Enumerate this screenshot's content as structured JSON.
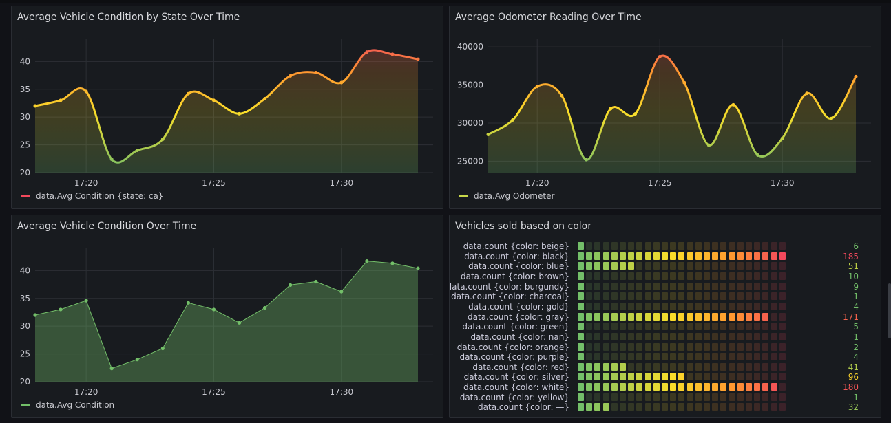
{
  "colors": {
    "green": "#73bf69",
    "yellow": "#fade2a",
    "orange": "#ff9830",
    "red": "#f2495c"
  },
  "panels": {
    "cond_state": {
      "title": "Average Vehicle Condition by State Over Time",
      "legend": "data.Avg Condition {state: ca}"
    },
    "odometer": {
      "title": "Average Odometer Reading Over Time",
      "legend": "data.Avg Odometer"
    },
    "cond": {
      "title": "Average Vehicle Condition Over Time",
      "legend": "data.Avg Condition"
    },
    "colors_sold": {
      "title": "Vehicles sold based on color"
    }
  },
  "chart_data": [
    {
      "type": "line",
      "title": "Average Vehicle Condition by State Over Time",
      "x": [
        "17:18",
        "17:19",
        "17:20",
        "17:21",
        "17:22",
        "17:23",
        "17:24",
        "17:25",
        "17:26",
        "17:27",
        "17:28",
        "17:29",
        "17:30",
        "17:31",
        "17:32",
        "17:33"
      ],
      "x_ticks": [
        "17:20",
        "17:25",
        "17:30"
      ],
      "series": [
        {
          "name": "data.Avg Condition {state: ca}",
          "values": [
            32,
            33,
            34.6,
            22.4,
            24,
            26,
            34.2,
            33,
            30.6,
            33.3,
            37.4,
            38,
            36.2,
            41.7,
            41.3,
            40.4
          ]
        }
      ],
      "ylim": [
        20,
        44
      ],
      "y_ticks": [
        20,
        25,
        30,
        35,
        40
      ],
      "line_style": "smooth",
      "color_scheme": "green-yellow-red gradient",
      "grid": true,
      "legend": "bottom-left"
    },
    {
      "type": "line",
      "title": "Average Odometer Reading Over Time",
      "x": [
        "17:18",
        "17:19",
        "17:20",
        "17:21",
        "17:22",
        "17:23",
        "17:24",
        "17:25",
        "17:26",
        "17:27",
        "17:28",
        "17:29",
        "17:30",
        "17:31",
        "17:32",
        "17:33"
      ],
      "x_ticks": [
        "17:20",
        "17:25",
        "17:30"
      ],
      "series": [
        {
          "name": "data.Avg Odometer",
          "values": [
            28500,
            30400,
            34800,
            33600,
            25200,
            31900,
            31200,
            38700,
            35300,
            27100,
            32400,
            25800,
            28000,
            33900,
            30600,
            36100
          ]
        }
      ],
      "ylim": [
        23500,
        41000
      ],
      "y_ticks": [
        25000,
        30000,
        35000,
        40000
      ],
      "line_style": "smooth",
      "color_scheme": "green-yellow-red gradient",
      "grid": true,
      "legend": "bottom-left"
    },
    {
      "type": "line",
      "title": "Average Vehicle Condition Over Time",
      "x": [
        "17:18",
        "17:19",
        "17:20",
        "17:21",
        "17:22",
        "17:23",
        "17:24",
        "17:25",
        "17:26",
        "17:27",
        "17:28",
        "17:29",
        "17:30",
        "17:31",
        "17:32",
        "17:33"
      ],
      "x_ticks": [
        "17:20",
        "17:25",
        "17:30"
      ],
      "series": [
        {
          "name": "data.Avg Condition",
          "values": [
            32,
            33,
            34.6,
            22.4,
            24,
            26,
            34.2,
            33,
            30.6,
            33.3,
            37.4,
            38,
            36.2,
            41.7,
            41.3,
            40.4
          ]
        }
      ],
      "ylim": [
        20,
        44
      ],
      "y_ticks": [
        20,
        25,
        30,
        35,
        40
      ],
      "line_style": "straight",
      "color": "#73bf69",
      "grid": true,
      "legend": "bottom-left"
    },
    {
      "type": "bar",
      "orientation": "horizontal",
      "display_mode": "retro LCD",
      "title": "Vehicles sold based on color",
      "max": 185,
      "categories": [
        "data.count {color: beige}",
        "data.count {color: black}",
        "data.count {color: blue}",
        "data.count {color: brown}",
        "data.count {color: burgundy}",
        "data.count {color: charcoal}",
        "data.count {color: gold}",
        "data.count {color: gray}",
        "data.count {color: green}",
        "data.count {color: nan}",
        "data.count {color: orange}",
        "data.count {color: purple}",
        "data.count {color: red}",
        "data.count {color: silver}",
        "data.count {color: white}",
        "data.count {color: yellow}",
        "data.count {color: —}"
      ],
      "values": [
        6,
        185,
        51,
        10,
        9,
        1,
        4,
        171,
        5,
        1,
        2,
        4,
        41,
        96,
        180,
        1,
        32
      ]
    }
  ]
}
